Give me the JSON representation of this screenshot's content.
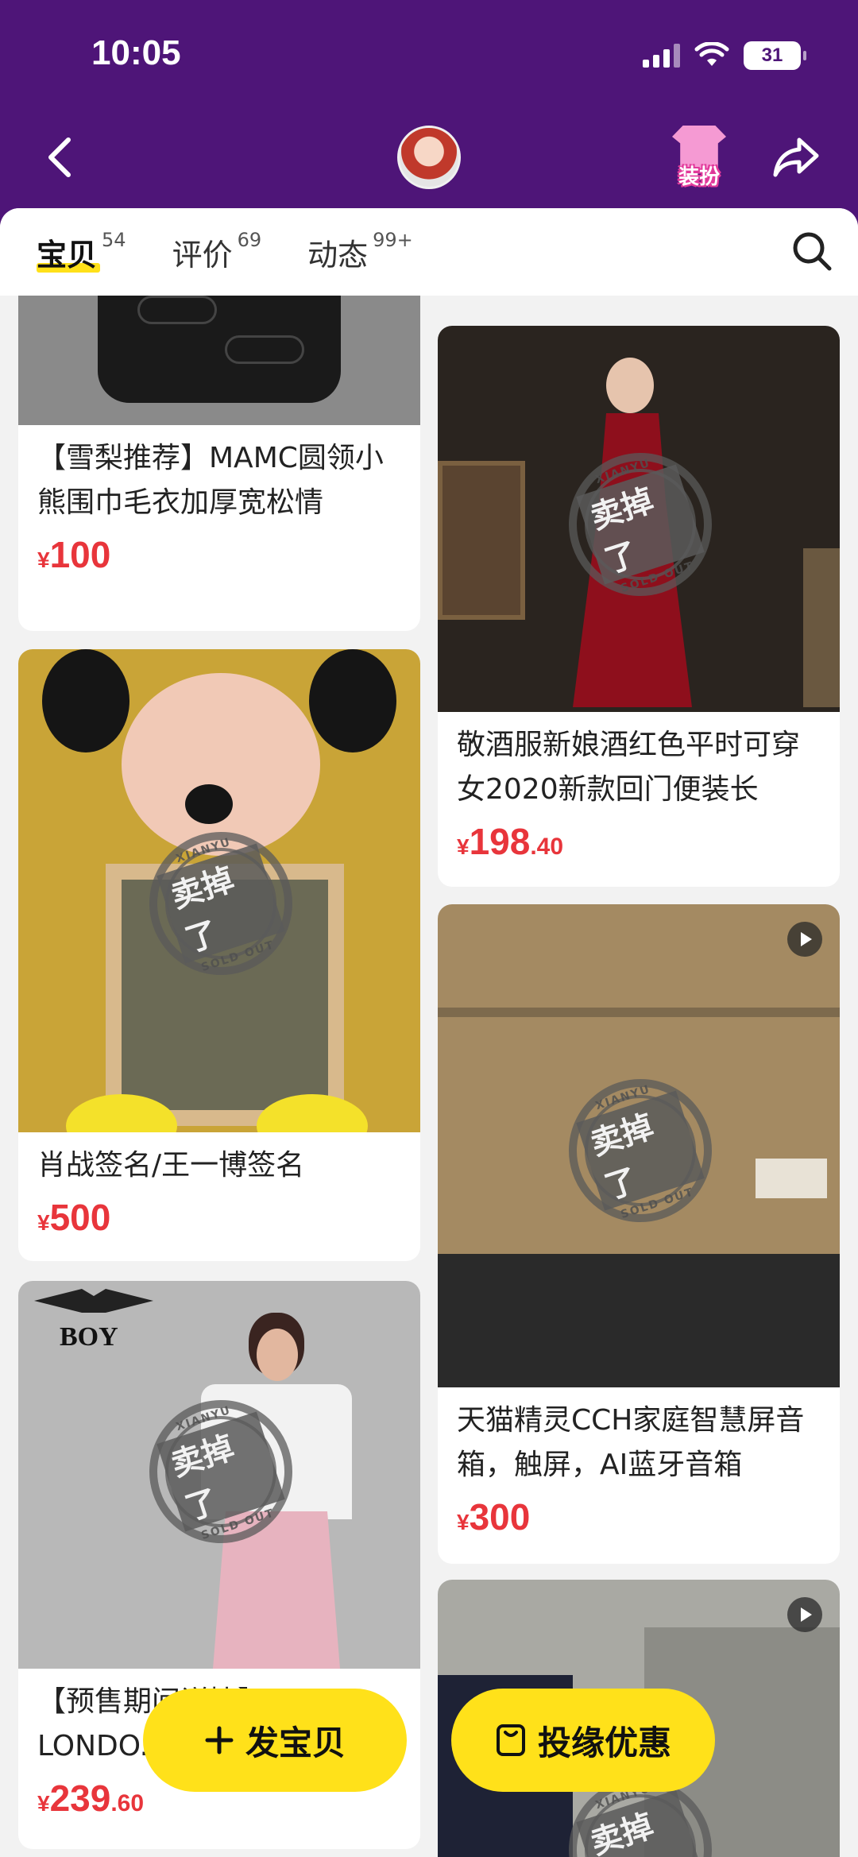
{
  "status_bar": {
    "time": "10:05",
    "battery": "31"
  },
  "nav": {
    "dress_up_label": "装扮"
  },
  "tabs": [
    {
      "label": "宝贝",
      "count": "54",
      "active": true
    },
    {
      "label": "评价",
      "count": "69",
      "active": false
    },
    {
      "label": "动态",
      "count": "99+",
      "active": false
    }
  ],
  "stamp": {
    "top": "XIANYU",
    "main": "卖掉了",
    "bottom": "SOLD OUT"
  },
  "items": [
    {
      "title": "【雪梨推荐】MAMC圆领小熊围巾毛衣加厚宽松情",
      "price_symbol": "¥",
      "price_int": "100",
      "price_dec": ""
    },
    {
      "title": "敬酒服新娘酒红色平时可穿女2020新款回门便装长",
      "price_symbol": "¥",
      "price_int": "198",
      "price_dec": ".40"
    },
    {
      "title": "肖战签名/王一博签名",
      "price_symbol": "¥",
      "price_int": "500",
      "price_dec": ""
    },
    {
      "title": "天猫精灵CCH家庭智慧屏音箱，触屏，AI蓝牙音箱",
      "price_symbol": "¥",
      "price_int": "300",
      "price_dec": ""
    },
    {
      "title": "【预售期间详情】... LONDO...",
      "price_symbol": "¥",
      "price_int": "239",
      "price_dec": ".60"
    }
  ],
  "boy_logo": "BOY",
  "fabs": {
    "post_label": "发宝贝",
    "promo_label": "投缘优惠"
  },
  "colors": {
    "header": "#4e1578",
    "accent": "#ffe11a",
    "price": "#e8353b"
  }
}
